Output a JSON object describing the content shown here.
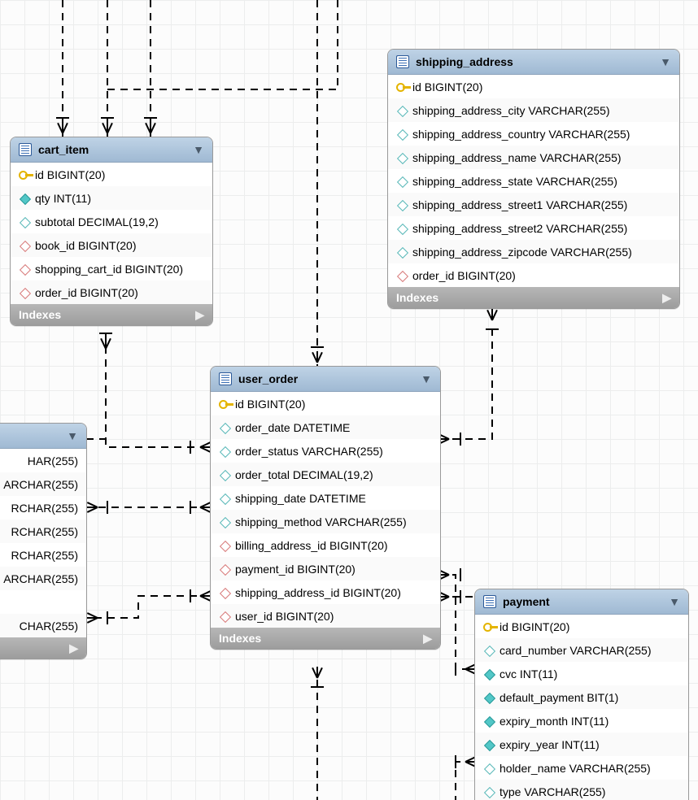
{
  "indexes_label": "Indexes",
  "tables": {
    "cart_item": {
      "title": "cart_item",
      "columns": [
        {
          "icon": "key",
          "label": "id BIGINT(20)"
        },
        {
          "icon": "diam-teal",
          "label": "qty INT(11)"
        },
        {
          "icon": "diam-hollow",
          "label": "subtotal DECIMAL(19,2)"
        },
        {
          "icon": "diam-pink",
          "label": "book_id BIGINT(20)"
        },
        {
          "icon": "diam-pink",
          "label": "shopping_cart_id BIGINT(20)"
        },
        {
          "icon": "diam-pink",
          "label": "order_id BIGINT(20)"
        }
      ]
    },
    "shipping_address": {
      "title": "shipping_address",
      "columns": [
        {
          "icon": "key",
          "label": "id BIGINT(20)"
        },
        {
          "icon": "diam-hollow",
          "label": "shipping_address_city VARCHAR(255)"
        },
        {
          "icon": "diam-hollow",
          "label": "shipping_address_country VARCHAR(255)"
        },
        {
          "icon": "diam-hollow",
          "label": "shipping_address_name VARCHAR(255)"
        },
        {
          "icon": "diam-hollow",
          "label": "shipping_address_state VARCHAR(255)"
        },
        {
          "icon": "diam-hollow",
          "label": "shipping_address_street1 VARCHAR(255)"
        },
        {
          "icon": "diam-hollow",
          "label": "shipping_address_street2 VARCHAR(255)"
        },
        {
          "icon": "diam-hollow",
          "label": "shipping_address_zipcode VARCHAR(255)"
        },
        {
          "icon": "diam-pink",
          "label": "order_id BIGINT(20)"
        }
      ]
    },
    "user_order": {
      "title": "user_order",
      "columns": [
        {
          "icon": "key",
          "label": "id BIGINT(20)"
        },
        {
          "icon": "diam-hollow",
          "label": "order_date DATETIME"
        },
        {
          "icon": "diam-hollow",
          "label": "order_status VARCHAR(255)"
        },
        {
          "icon": "diam-hollow",
          "label": "order_total DECIMAL(19,2)"
        },
        {
          "icon": "diam-hollow",
          "label": "shipping_date DATETIME"
        },
        {
          "icon": "diam-hollow",
          "label": "shipping_method VARCHAR(255)"
        },
        {
          "icon": "diam-pink",
          "label": "billing_address_id BIGINT(20)"
        },
        {
          "icon": "diam-pink",
          "label": "payment_id BIGINT(20)"
        },
        {
          "icon": "diam-pink",
          "label": "shipping_address_id BIGINT(20)"
        },
        {
          "icon": "diam-pink",
          "label": "user_id BIGINT(20)"
        }
      ]
    },
    "payment": {
      "title": "payment",
      "columns": [
        {
          "icon": "key",
          "label": "id BIGINT(20)"
        },
        {
          "icon": "diam-hollow",
          "label": "card_number VARCHAR(255)"
        },
        {
          "icon": "diam-teal",
          "label": "cvc INT(11)"
        },
        {
          "icon": "diam-teal",
          "label": "default_payment BIT(1)"
        },
        {
          "icon": "diam-teal",
          "label": "expiry_month INT(11)"
        },
        {
          "icon": "diam-teal",
          "label": "expiry_year INT(11)"
        },
        {
          "icon": "diam-hollow",
          "label": "holder_name VARCHAR(255)"
        },
        {
          "icon": "diam-hollow",
          "label": "type VARCHAR(255)"
        }
      ]
    },
    "left_partial": {
      "columns": [
        {
          "icon": "blank",
          "label": "HAR(255)"
        },
        {
          "icon": "blank",
          "label": "ARCHAR(255)"
        },
        {
          "icon": "blank",
          "label": "RCHAR(255)"
        },
        {
          "icon": "blank",
          "label": "RCHAR(255)"
        },
        {
          "icon": "blank",
          "label": "RCHAR(255)"
        },
        {
          "icon": "blank",
          "label": "ARCHAR(255)"
        },
        {
          "icon": "blank",
          "label": ""
        },
        {
          "icon": "blank",
          "label": "CHAR(255)"
        }
      ]
    }
  }
}
